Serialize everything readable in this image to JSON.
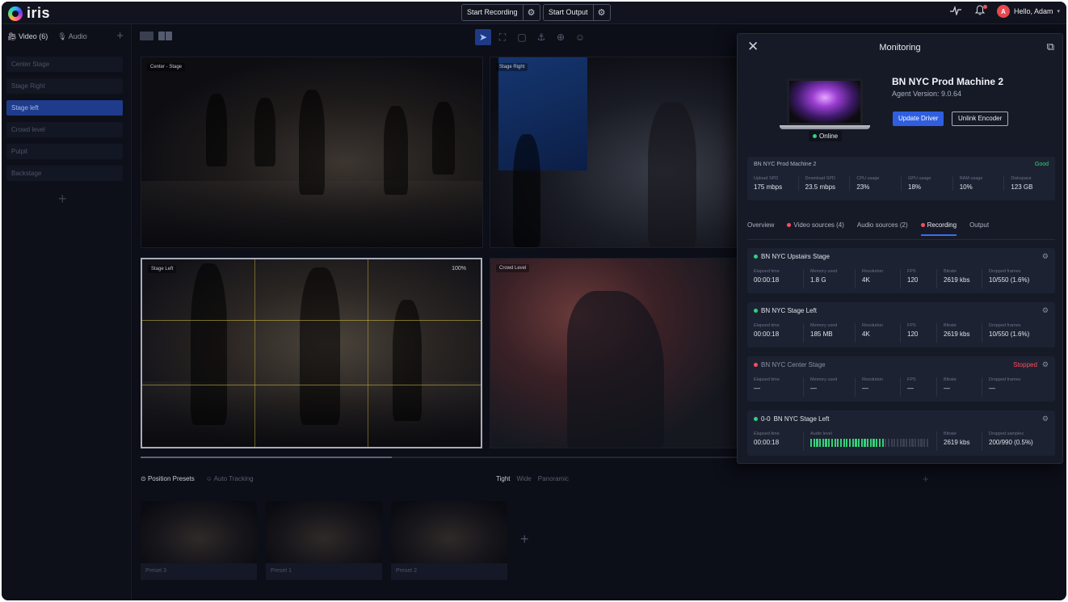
{
  "app": {
    "name": "iris"
  },
  "topbar": {
    "start_recording": "Start Recording",
    "start_output": "Start Output",
    "greeting": "Hello, Adam",
    "avatar_initial": "A"
  },
  "left_panel": {
    "tabs": [
      {
        "label": "Video (6)",
        "active": true
      },
      {
        "label": "Audio",
        "active": false
      }
    ],
    "sources": [
      "Center Stage",
      "Stage Right",
      "Stage left",
      "Crowd level",
      "Pulpit",
      "Backstage"
    ],
    "selected_source": "Stage left"
  },
  "tiles": [
    {
      "label": "Center - Stage"
    },
    {
      "label": "Stage Right"
    },
    {
      "label": "Stage Left",
      "zoom": "100%"
    },
    {
      "label": "Crowd Level"
    }
  ],
  "scrub_progress": 0.42,
  "presets": {
    "tabs": [
      {
        "label": "Position Presets",
        "active": true
      },
      {
        "label": "Auto Tracking",
        "active": false
      }
    ],
    "zoom_tabs": [
      {
        "label": "Tight",
        "active": true
      },
      {
        "label": "Wide",
        "active": false
      },
      {
        "label": "Panoramic",
        "active": false
      }
    ],
    "items": [
      "Preset 3",
      "Preset 1",
      "Preset 2"
    ]
  },
  "monitoring": {
    "title": "Monitoring",
    "status_badge": "Online",
    "machine_name": "BN NYC Prod Machine 2",
    "agent_version": "Agent Version: 9.0.64",
    "update_driver": "Update Driver",
    "unlink_encoder": "Unlink Encoder",
    "stats": {
      "name": "BN NYC Prod Machine 2",
      "status": "Good",
      "columns": [
        {
          "label": "Upload SPD",
          "value": "175 mbps"
        },
        {
          "label": "Download SPD",
          "value": "23.5 mbps"
        },
        {
          "label": "CPU usage",
          "value": "23%"
        },
        {
          "label": "GPU usage",
          "value": "18%"
        },
        {
          "label": "RAM usage",
          "value": "10%"
        },
        {
          "label": "Diskspace",
          "value": "123 GB"
        }
      ]
    },
    "tabs": [
      {
        "label": "Overview",
        "dot": false,
        "active": false
      },
      {
        "label": "Video sources (4)",
        "dot": true,
        "active": false
      },
      {
        "label": "Audio sources (2)",
        "dot": false,
        "active": false
      },
      {
        "label": "Recording",
        "dot": true,
        "active": true
      },
      {
        "label": "Output",
        "dot": false,
        "active": false
      }
    ],
    "recordings": [
      {
        "name": "BN NYC Upstairs Stage",
        "status_color": "#32d27a",
        "stopped": "",
        "columns": [
          {
            "label": "Elapsed time",
            "value": "00:00:18"
          },
          {
            "label": "Memory used",
            "value": "1.8 G"
          },
          {
            "label": "Resolution",
            "value": "4K"
          },
          {
            "label": "FPS",
            "value": "120"
          },
          {
            "label": "Bitrate",
            "value": "2619 kbs"
          },
          {
            "label": "Dropped frames",
            "value": "10/550 (1.6%)"
          }
        ]
      },
      {
        "name": "BN NYC Stage Left",
        "status_color": "#32d27a",
        "stopped": "",
        "columns": [
          {
            "label": "Elapsed time",
            "value": "00:00:18"
          },
          {
            "label": "Memory used",
            "value": "185 MB"
          },
          {
            "label": "Resolution",
            "value": "4K"
          },
          {
            "label": "FPS",
            "value": "120"
          },
          {
            "label": "Bitrate",
            "value": "2619 kbs"
          },
          {
            "label": "Dropped frames",
            "value": "10/550 (1.6%)"
          }
        ]
      },
      {
        "name": "BN NYC Center Stage",
        "status_color": "#ff4c5e",
        "stopped": "Stopped",
        "columns": [
          {
            "label": "Elapsed time",
            "value": "—"
          },
          {
            "label": "Memory used",
            "value": "—"
          },
          {
            "label": "Resolution",
            "value": "—"
          },
          {
            "label": "FPS",
            "value": "—"
          },
          {
            "label": "Bitrate",
            "value": "—"
          },
          {
            "label": "Dropped frames",
            "value": "—"
          }
        ]
      }
    ],
    "audio_recording": {
      "prefix": "0-0",
      "name": "BN NYC Stage Left",
      "elapsed_label": "Elapsed time",
      "elapsed": "00:00:18",
      "level_label": "Audio level",
      "level": 0.62,
      "bitrate_label": "Bitrate",
      "bitrate": "2619 kbs",
      "dropped_label": "Dropped samples",
      "dropped": "200/990 (0.5%)"
    }
  }
}
